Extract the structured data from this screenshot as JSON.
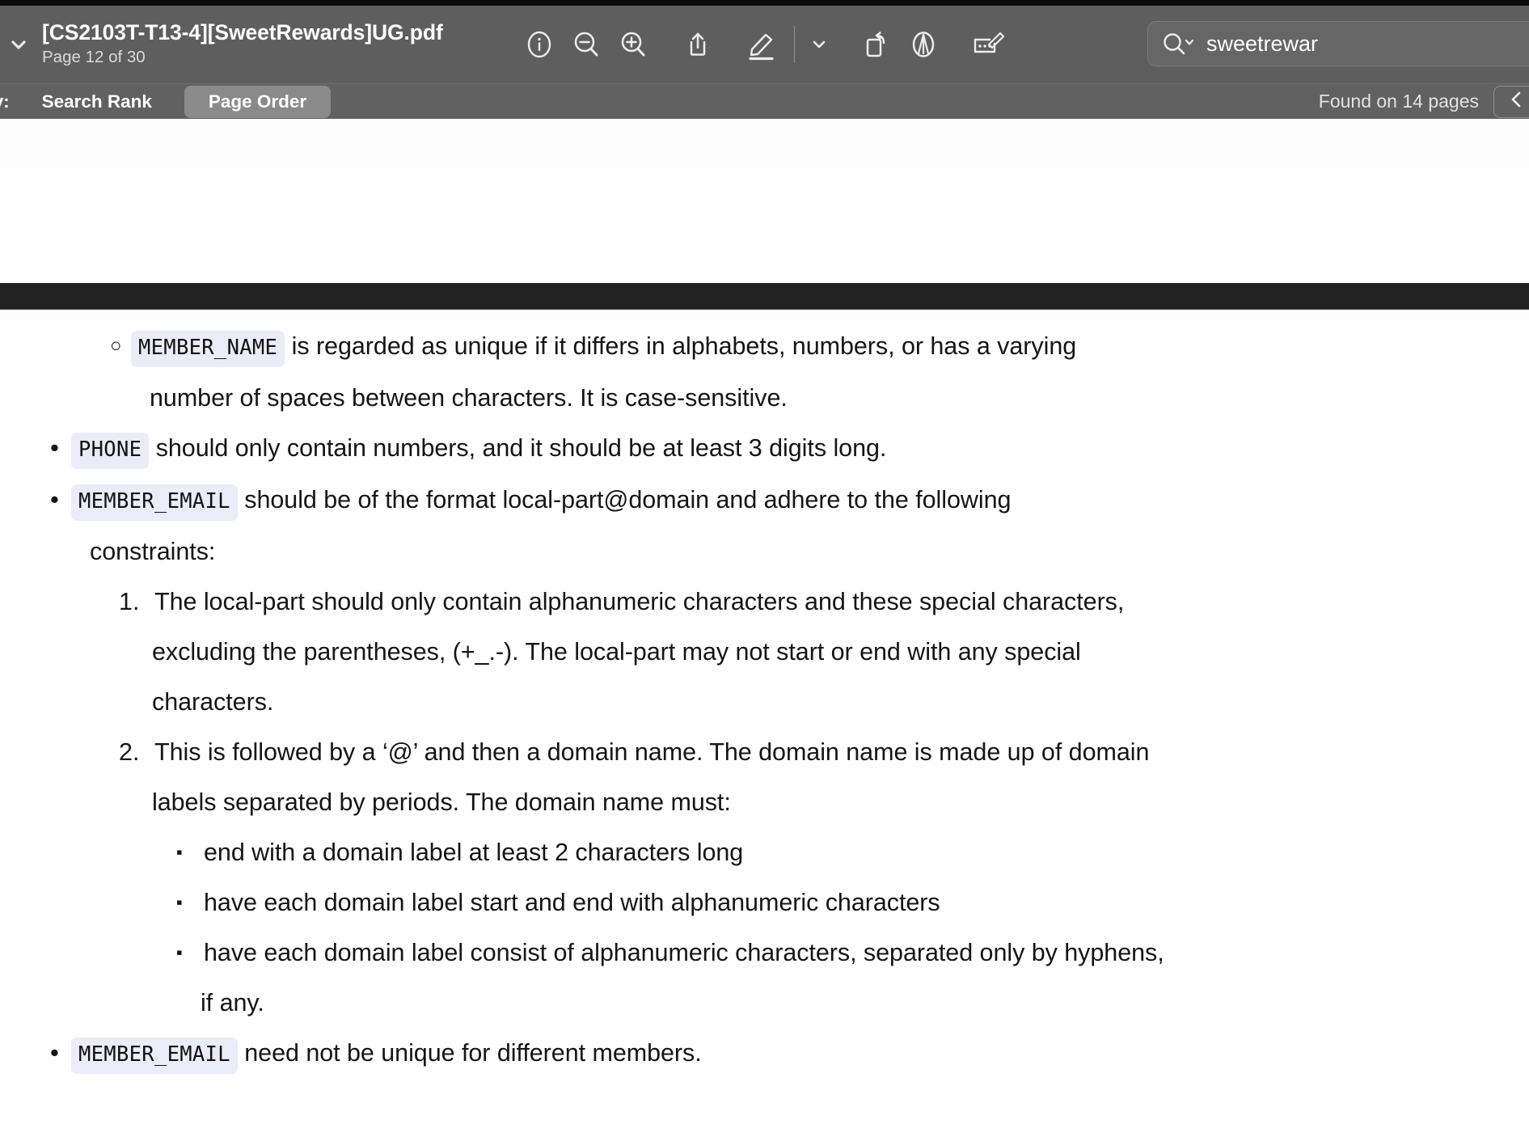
{
  "window": {
    "doc_title": "[CS2103T-T13-4][SweetRewards]UG.pdf",
    "page_indicator": "Page 12 of 30"
  },
  "toolbar": {
    "chevron_icon": "chevron-down-icon",
    "icons": [
      {
        "name": "info-icon",
        "label": "Info"
      },
      {
        "name": "zoom-out-icon",
        "label": "Zoom Out"
      },
      {
        "name": "zoom-in-icon",
        "label": "Zoom In"
      },
      {
        "name": "share-icon",
        "label": "Share"
      },
      {
        "name": "markup-highlight-icon",
        "label": "Highlight"
      },
      {
        "name": "markup-options-chevron-icon",
        "label": "Markup Options"
      },
      {
        "name": "rotate-icon",
        "label": "Rotate"
      },
      {
        "name": "annotate-icon",
        "label": "Annotate"
      },
      {
        "name": "redact-icon",
        "label": "Redact"
      }
    ]
  },
  "search": {
    "icon": "search-icon",
    "dropdown_icon": "chevron-down-icon",
    "value": "sweetrewar",
    "placeholder": "Search"
  },
  "search_bar": {
    "sort_label": "y:",
    "options": [
      {
        "label": "Search Rank",
        "active": false
      },
      {
        "label": "Page Order",
        "active": true
      }
    ],
    "results_summary": "Found on 14 pages",
    "prev_icon": "chevron-left-icon"
  },
  "document": {
    "blocks": [
      {
        "kind": "circle-bullet",
        "indent": "lvl-c1",
        "cont_indent": "cont-c1",
        "marker": "○",
        "lines": [
          {
            "code": "MEMBER_NAME",
            "text": " is regarded as unique if it differs in alphabets, numbers, or has a varying"
          },
          {
            "code": null,
            "text": "number of spaces between characters. It is case-sensitive."
          }
        ]
      },
      {
        "kind": "bullet",
        "indent": "lvl-b1",
        "cont_indent": "cont-b1",
        "marker": "•",
        "lines": [
          {
            "code": "PHONE",
            "text": " should only contain numbers, and it should be at least 3 digits long."
          }
        ]
      },
      {
        "kind": "bullet",
        "indent": "lvl-b1",
        "cont_indent": "cont-b1",
        "marker": "•",
        "lines": [
          {
            "code": "MEMBER_EMAIL",
            "text": " should be of the format local-part@domain and adhere to the following"
          },
          {
            "code": null,
            "text": "constraints:"
          }
        ]
      },
      {
        "kind": "number",
        "indent": "lvl-n1",
        "cont_indent": "cont-n1",
        "marker": "1.",
        "lines": [
          {
            "code": null,
            "text": "The local-part should only contain alphanumeric characters and these special characters,"
          },
          {
            "code": null,
            "text": "excluding the parentheses, (+_.-). The local-part may not start or end with any special"
          },
          {
            "code": null,
            "text": "characters."
          }
        ]
      },
      {
        "kind": "number",
        "indent": "lvl-n1",
        "cont_indent": "cont-n1",
        "marker": "2.",
        "lines": [
          {
            "code": null,
            "text": "This is followed by a ‘@’ and then a domain name. The domain name is made up of domain"
          },
          {
            "code": null,
            "text": "labels separated by periods. The domain name must:"
          }
        ]
      },
      {
        "kind": "square",
        "indent": "lvl-s1",
        "cont_indent": "cont-s1",
        "marker": "▪",
        "lines": [
          {
            "code": null,
            "text": "end with a domain label at least 2 characters long"
          }
        ]
      },
      {
        "kind": "square",
        "indent": "lvl-s1",
        "cont_indent": "cont-s1",
        "marker": "▪",
        "lines": [
          {
            "code": null,
            "text": "have each domain label start and end with alphanumeric characters"
          }
        ]
      },
      {
        "kind": "square",
        "indent": "lvl-s1",
        "cont_indent": "cont-s1",
        "marker": "▪",
        "lines": [
          {
            "code": null,
            "text": "have each domain label consist of alphanumeric characters, separated only by hyphens,"
          },
          {
            "code": null,
            "text": "if any."
          }
        ]
      },
      {
        "kind": "bullet",
        "indent": "lvl-b1",
        "cont_indent": "cont-b1",
        "marker": "•",
        "lines": [
          {
            "code": "MEMBER_EMAIL",
            "text": " need not be unique for different members."
          }
        ]
      }
    ]
  },
  "colors": {
    "toolbar_bg": "#5e5e5e",
    "toolbar2_bg": "#616161",
    "page_gap": "#232323",
    "code_chip_bg": "#ecebf8",
    "segment_active_bg": "#8a8a8a"
  }
}
